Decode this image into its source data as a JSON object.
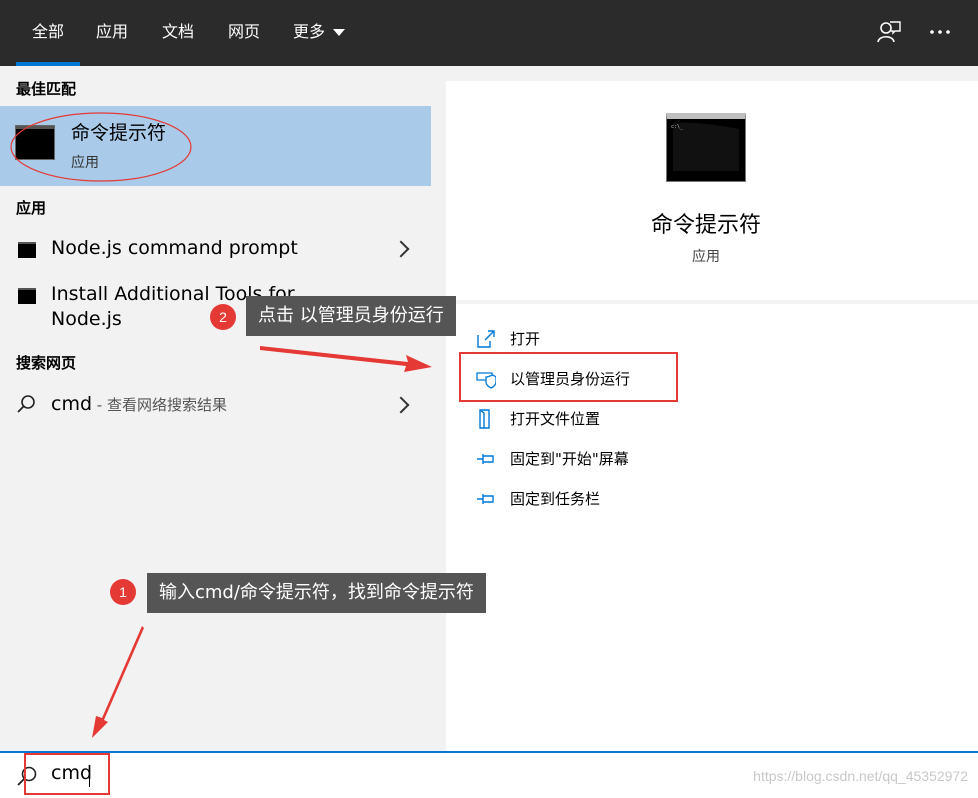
{
  "tabs": [
    {
      "label": "全部",
      "active": true
    },
    {
      "label": "应用"
    },
    {
      "label": "文档"
    },
    {
      "label": "网页"
    },
    {
      "label": "更多"
    }
  ],
  "top_icons": [
    "feedback-icon",
    "more-options-icon"
  ],
  "left": {
    "best_match_title": "最佳匹配",
    "best_match": {
      "name": "命令提示符",
      "type": "应用"
    },
    "apps_title": "应用",
    "apps": [
      {
        "label": "Node.js command prompt"
      },
      {
        "label_line1": "Install Additional Tools for",
        "label_line2": "Node.js"
      }
    ],
    "web_title": "搜索网页",
    "web_search": {
      "query": "cmd",
      "suffix": " - 查看网络搜索结果"
    }
  },
  "right": {
    "app_name": "命令提示符",
    "app_type": "应用",
    "actions": [
      {
        "label": "打开",
        "icon": "open-icon"
      },
      {
        "label": "以管理员身份运行",
        "icon": "shield-icon"
      },
      {
        "label": "打开文件位置",
        "icon": "file-location-icon"
      },
      {
        "label": "固定到\"开始\"屏幕",
        "icon": "pin-icon"
      },
      {
        "label": "固定到任务栏",
        "icon": "pin-icon"
      }
    ]
  },
  "search": {
    "value": "cmd",
    "watermark": "https://blog.csdn.net/qq_45352972"
  },
  "annotations": {
    "step1": {
      "number": "1",
      "text": "输入cmd/命令提示符，找到命令提示符"
    },
    "step2": {
      "number": "2",
      "text": "点击 以管理员身份运行"
    }
  },
  "colors": {
    "accent": "#0078d7",
    "annotation_red": "#e53935",
    "selection": "#a9cbe9",
    "topbar": "#2b2b2b"
  }
}
